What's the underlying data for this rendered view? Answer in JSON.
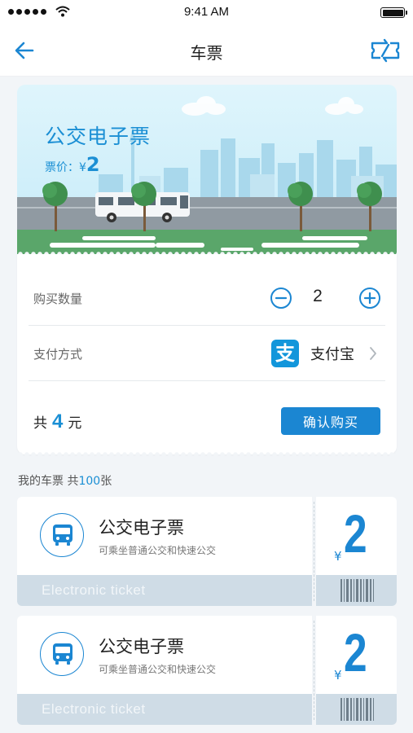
{
  "status_bar": {
    "time": "9:41 AM"
  },
  "nav": {
    "title": "车票"
  },
  "hero": {
    "title": "公交电子票",
    "price_label": "票价：¥",
    "price_value": "2"
  },
  "purchase": {
    "quantity_label": "购买数量",
    "quantity_value": "2",
    "payment_label": "支付方式",
    "payment_logo_glyph": "支",
    "payment_method": "支付宝",
    "total_prefix": "共",
    "total_amount": "4",
    "total_unit": "元",
    "confirm_label": "确认购买"
  },
  "my_tickets": {
    "label": "我的车票  共",
    "count": "100",
    "unit": "张"
  },
  "tickets": [
    {
      "name": "公交电子票",
      "description": "可乘坐普通公交和快速公交",
      "footer": "Electronic ticket",
      "currency": "¥",
      "value": "2"
    },
    {
      "name": "公交电子票",
      "description": "可乘坐普通公交和快速公交",
      "footer": "Electronic ticket",
      "currency": "¥",
      "value": "2"
    }
  ],
  "icons": {
    "back": "arrow-left-icon",
    "exchange": "exchange-icon",
    "minus": "minus-circle-icon",
    "plus": "plus-circle-icon",
    "alipay": "alipay-icon",
    "chevron": "chevron-right-icon",
    "bus": "bus-icon"
  },
  "colors": {
    "accent": "#1b86d2",
    "accent_light": "#1b8fd4",
    "background": "#f2f5f8",
    "ticket_footer": "#cfdce6"
  }
}
